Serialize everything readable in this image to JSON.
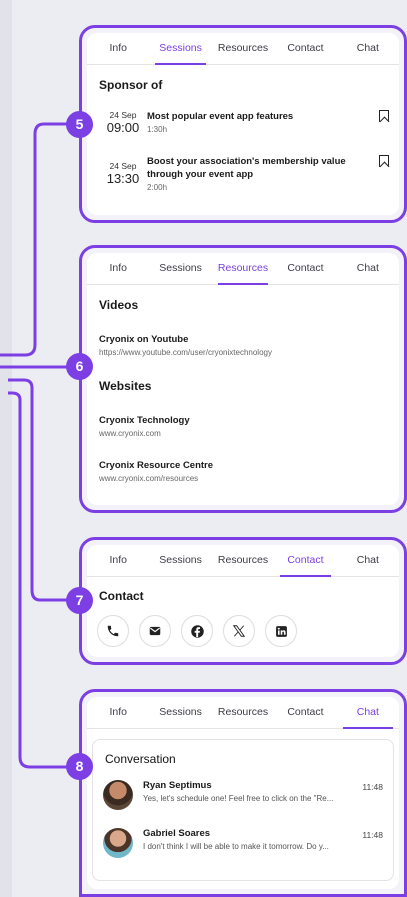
{
  "tabs": [
    "Info",
    "Sessions",
    "Resources",
    "Contact",
    "Chat"
  ],
  "sessions": {
    "heading": "Sponsor of",
    "items": [
      {
        "day": "24 Sep",
        "time": "09:00",
        "title": "Most popular event app features",
        "duration": "1:30h"
      },
      {
        "day": "24 Sep",
        "time": "13:30",
        "title": "Boost your association's membership value through your event app",
        "duration": "2:00h"
      }
    ]
  },
  "resources": {
    "videos_heading": "Videos",
    "videos": [
      {
        "title": "Cryonix on Youtube",
        "url": "https://www.youtube.com/user/cryonixtechnology"
      }
    ],
    "websites_heading": "Websites",
    "websites": [
      {
        "title": "Cryonix Technology",
        "url": "www.cryonix.com"
      },
      {
        "title": "Cryonix Resource Centre",
        "url": "www.cryonix.com/resources"
      }
    ]
  },
  "contact": {
    "heading": "Contact",
    "icons": [
      "phone-icon",
      "mail-icon",
      "facebook-icon",
      "x-icon",
      "linkedin-icon"
    ]
  },
  "chat": {
    "heading": "Conversation",
    "messages": [
      {
        "name": "Ryan Septimus",
        "time": "11:48",
        "text": "Yes, let's schedule one! Feel free to click on the \"Re..."
      },
      {
        "name": "Gabriel Soares",
        "time": "11:48",
        "text": "I don't think I will be able to make it tomorrow. Do y..."
      }
    ]
  },
  "badges": [
    "5",
    "6",
    "7",
    "8"
  ],
  "colors": {
    "accent": "#7b3fe4"
  }
}
